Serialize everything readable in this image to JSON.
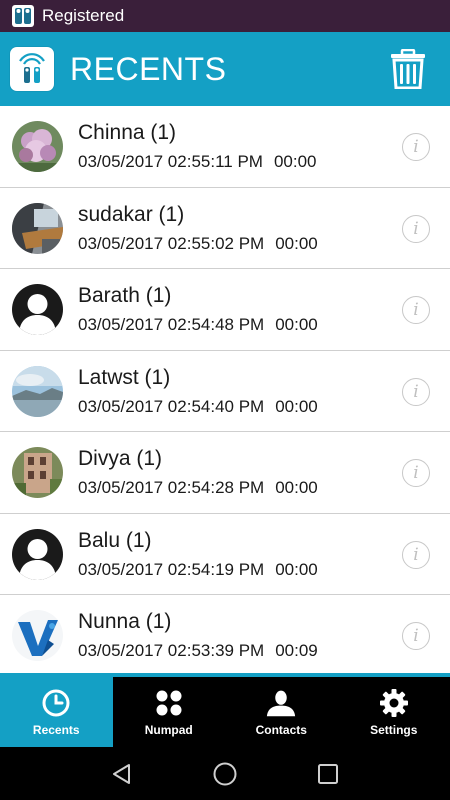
{
  "status_bar": {
    "text": "Registered"
  },
  "header": {
    "title": "RECENTS"
  },
  "recents": [
    {
      "name": "Chinna (1)",
      "date": "03/05/2017 02:55:11 PM",
      "duration": "00:00",
      "avatar": "flower-photo"
    },
    {
      "name": "sudakar (1)",
      "date": "03/05/2017 02:55:02 PM",
      "duration": "00:00",
      "avatar": "desk-photo"
    },
    {
      "name": "Barath (1)",
      "date": "03/05/2017 02:54:48 PM",
      "duration": "00:00",
      "avatar": "default-person"
    },
    {
      "name": "Latwst (1)",
      "date": "03/05/2017 02:54:40 PM",
      "duration": "00:00",
      "avatar": "landscape-photo"
    },
    {
      "name": "Divya (1)",
      "date": "03/05/2017 02:54:28 PM",
      "duration": "00:00",
      "avatar": "building-photo"
    },
    {
      "name": "Balu (1)",
      "date": "03/05/2017 02:54:19 PM",
      "duration": "00:00",
      "avatar": "default-person"
    },
    {
      "name": "Nunna (1)",
      "date": "03/05/2017 02:53:39 PM",
      "duration": "00:09",
      "avatar": "v-logo"
    }
  ],
  "tabs": [
    {
      "label": "Recents",
      "icon": "clock-icon",
      "active": true
    },
    {
      "label": "Numpad",
      "icon": "numpad-icon",
      "active": false
    },
    {
      "label": "Contacts",
      "icon": "person-icon",
      "active": false
    },
    {
      "label": "Settings",
      "icon": "gear-icon",
      "active": false
    }
  ],
  "colors": {
    "accent": "#14a0c5",
    "status_bar": "#3a1f3a",
    "tab_bar": "#000000",
    "divider": "#cfcfcf"
  }
}
